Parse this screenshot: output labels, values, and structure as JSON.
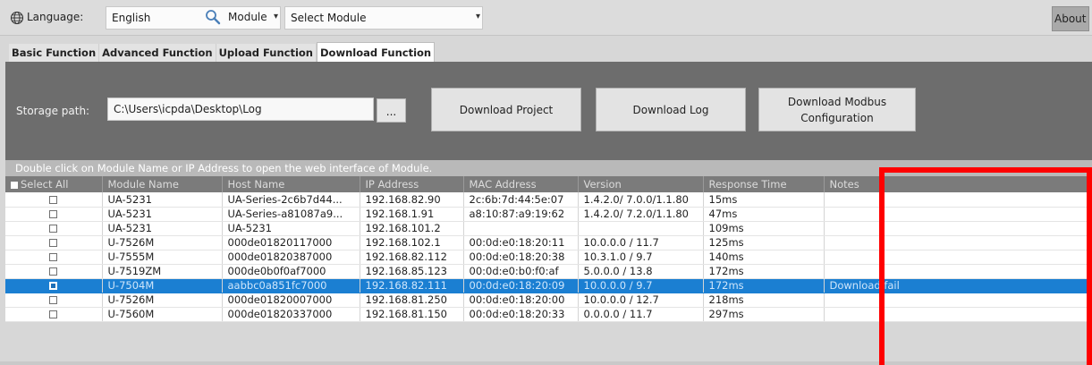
{
  "toolbar": {
    "language_label": "Language:",
    "language_value": "English",
    "module_label": "Module",
    "module_value": "Select Module",
    "about_label": "About"
  },
  "icons": {
    "globe": "globe-icon",
    "search": "search-icon",
    "dropdown": "chevron-down-icon"
  },
  "tabs": [
    {
      "label": "Basic Function",
      "active": false
    },
    {
      "label": "Advanced Function",
      "active": false
    },
    {
      "label": "Upload Function",
      "active": false
    },
    {
      "label": "Download Function",
      "active": true
    }
  ],
  "panel": {
    "storage_label": "Storage path:",
    "storage_value": "C:\\Users\\icpda\\Desktop\\Log",
    "browse_label": "...",
    "download_project": "Download Project",
    "download_log": "Download Log",
    "download_modbus_line1": "Download Modbus",
    "download_modbus_line2": "Configuration"
  },
  "info_text": "Double click on Module Name or IP Address to open the web interface of Module.",
  "table": {
    "headers": [
      "Select All",
      "Module Name",
      "Host Name",
      "IP Address",
      "MAC Address",
      "Version",
      "Response Time",
      "Notes"
    ],
    "rows": [
      {
        "checked": false,
        "module": "UA-5231",
        "host": "UA-Series-2c6b7d44...",
        "ip": "192.168.82.90",
        "mac": "2c:6b:7d:44:5e:07",
        "version": "1.4.2.0/ 7.0.0/1.1.80",
        "response": "15ms",
        "notes": ""
      },
      {
        "checked": false,
        "module": "UA-5231",
        "host": "UA-Series-a81087a9...",
        "ip": "192.168.1.91",
        "mac": "a8:10:87:a9:19:62",
        "version": "1.4.2.0/ 7.2.0/1.1.80",
        "response": "47ms",
        "notes": ""
      },
      {
        "checked": false,
        "module": "UA-5231",
        "host": "UA-5231",
        "ip": "192.168.101.2",
        "mac": "",
        "version": "",
        "response": "109ms",
        "notes": ""
      },
      {
        "checked": false,
        "module": "U-7526M",
        "host": "000de01820117000",
        "ip": "192.168.102.1",
        "mac": "00:0d:e0:18:20:11",
        "version": "10.0.0.0 / 11.7",
        "response": "125ms",
        "notes": ""
      },
      {
        "checked": false,
        "module": "U-7555M",
        "host": "000de01820387000",
        "ip": "192.168.82.112",
        "mac": "00:0d:e0:18:20:38",
        "version": "10.3.1.0 / 9.7",
        "response": "140ms",
        "notes": ""
      },
      {
        "checked": false,
        "module": "U-7519ZM",
        "host": "000de0b0f0af7000",
        "ip": "192.168.85.123",
        "mac": "00:0d:e0:b0:f0:af",
        "version": "5.0.0.0 / 13.8",
        "response": "172ms",
        "notes": ""
      },
      {
        "checked": true,
        "module": "U-7504M",
        "host": "aabbc0a851fc7000",
        "ip": "192.168.82.111",
        "mac": "00:0d:e0:18:20:09",
        "version": "10.0.0.0 / 9.7",
        "response": "172ms",
        "notes": "Download fail"
      },
      {
        "checked": false,
        "module": "U-7526M",
        "host": "000de01820007000",
        "ip": "192.168.81.250",
        "mac": "00:0d:e0:18:20:00",
        "version": "10.0.0.0 / 12.7",
        "response": "218ms",
        "notes": ""
      },
      {
        "checked": false,
        "module": "U-7560M",
        "host": "000de01820337000",
        "ip": "192.168.81.150",
        "mac": "00:0d:e0:18:20:33",
        "version": "0.0.0.0 / 11.7",
        "response": "297ms",
        "notes": ""
      }
    ]
  },
  "colors": {
    "selected_row": "#1b7fd2",
    "highlight": "#ff0000",
    "panel": "#6d6d6d"
  }
}
